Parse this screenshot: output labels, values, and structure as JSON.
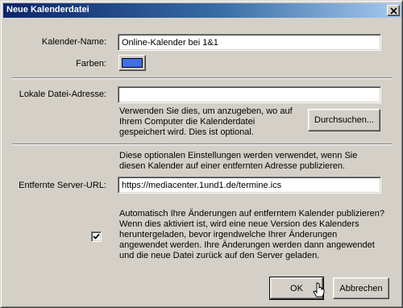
{
  "window": {
    "title": "Neue Kalenderdatei",
    "close_icon": "close-icon"
  },
  "calendar": {
    "name_label": "Kalender-Name:",
    "name_value": "Online-Kalender bei 1&1",
    "color_label": "Farben:",
    "color_value": "#3f6fe8"
  },
  "local": {
    "address_label": "Lokale Datei-Adresse:",
    "address_value": "",
    "help_text": "Verwenden Sie dies, um anzugeben, wo auf Ihrem Computer die Kalenderdatei gespeichert wird. Dies ist optional.",
    "browse_label": "Durchsuchen..."
  },
  "remote": {
    "intro_text": "Diese optionalen Einstellungen werden verwendet, wenn Sie diesen Kalender auf einer entfernten Adresse publizieren.",
    "server_label": "Entfernte Server-URL:",
    "server_value": "https://mediacenter.1und1.de/termine.ics",
    "auto_publish_checked": true,
    "auto_publish_text": "Automatisch Ihre Änderungen auf entferntem Kalender publizieren? Wenn dies aktiviert ist, wird eine neue Version des Kalenders heruntergeladen, bevor irgendwelche Ihrer Änderungen angewendet werden. Ihre Änderungen werden dann angewendet und die neue Datei zurück auf den Server geladen."
  },
  "footer": {
    "ok_label": "OK",
    "cancel_label": "Abbrechen"
  }
}
